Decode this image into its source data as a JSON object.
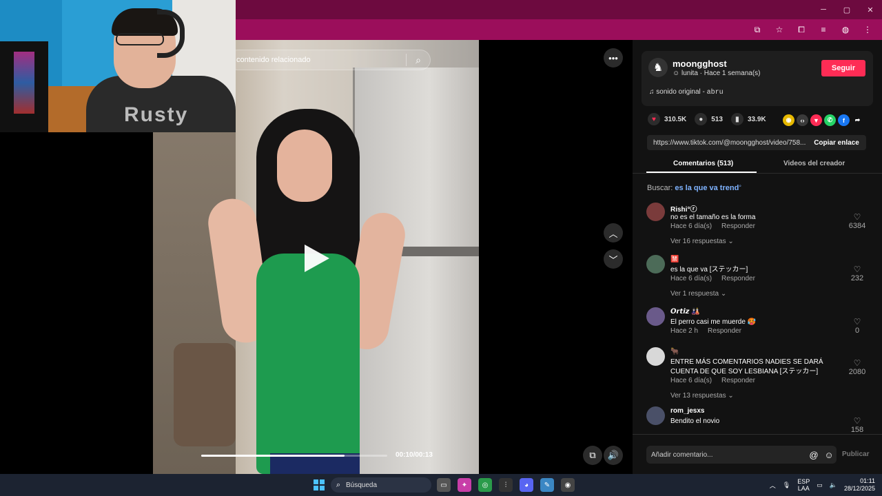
{
  "browser": {
    "window_controls": {
      "minimize": "─",
      "maximize": "▢",
      "close": "✕"
    }
  },
  "video": {
    "search_placeholder": "contenido relacionado",
    "time": "00:10/00:13",
    "progress_fraction": 0.77
  },
  "webcam": {
    "shirt_text": "Rusty"
  },
  "author": {
    "name": "moongghost",
    "subtitle": "☺ lunita · Hace 1 semana(s)",
    "follow_label": "Seguir",
    "sound_label": "sonido original - ",
    "sound_artist": "abru"
  },
  "stats": {
    "likes": "310.5K",
    "comments": "513",
    "saves": "33.9K"
  },
  "share_icons": [
    {
      "name": "coin-icon",
      "glyph": "◉",
      "color": "#e6b800"
    },
    {
      "name": "embed-icon",
      "glyph": "‹›",
      "color": "#3a3a3a"
    },
    {
      "name": "send-icon",
      "glyph": "▼",
      "color": "#fe2c55"
    },
    {
      "name": "whatsapp-icon",
      "glyph": "✆",
      "color": "#25d366"
    },
    {
      "name": "facebook-icon",
      "glyph": "f",
      "color": "#1877f2"
    },
    {
      "name": "share-arrow-icon",
      "glyph": "➦",
      "color": "#121212"
    }
  ],
  "link": {
    "url": "https://www.tiktok.com/@moongghost/video/758...",
    "copy_label": "Copiar enlace"
  },
  "tabs": {
    "comments": "Comentarios (513)",
    "creator_videos": "Videos del creador"
  },
  "search_tip": {
    "prefix": "Buscar: ",
    "keyword": "es la que va trend"
  },
  "comments": [
    {
      "user": "Rishi°ⓡ",
      "text": "no es el tamaño es la forma",
      "time": "Hace 6 día(s)",
      "reply": "Responder",
      "likes": "6384",
      "replies": "Ver 16 respuestas ⌄",
      "avatar_color": "#7a3b3b"
    },
    {
      "user": "🈲",
      "text": "es la que va [ステッカー]",
      "time": "Hace 6 día(s)",
      "reply": "Responder",
      "likes": "232",
      "replies": "Ver 1 respuesta ⌄",
      "avatar_color": "#4c6b58"
    },
    {
      "user": "𝙊𝙧𝙩𝙞𝙯 🎎",
      "text": "El perro casi me muerde 🥵",
      "time": "Hace 2 h",
      "reply": "Responder",
      "likes": "0",
      "replies": "",
      "avatar_color": "#6a5a8a"
    },
    {
      "user": "🐂",
      "text": "ENTRE MÁS COMENTARIOS NADIES SE DARÁ CUENTA DE QUE SOY LESBIANA [ステッカー]",
      "time": "Hace 6 día(s)",
      "reply": "Responder",
      "likes": "2080",
      "replies": "Ver 13 respuestas ⌄",
      "avatar_color": "#d8d8d8"
    },
    {
      "user": "rom_jesxs",
      "text": "Bendito el novio",
      "time": "",
      "reply": "",
      "likes": "158",
      "replies": "",
      "avatar_color": "#4a5068"
    }
  ],
  "comment_input": {
    "placeholder": "Añadir comentario...",
    "publish": "Publicar"
  },
  "taskbar": {
    "search_label": "Búsqueda",
    "lang_top": "ESP",
    "lang_bottom": "LAA",
    "time": "01:11",
    "date": "28/12/2025"
  }
}
